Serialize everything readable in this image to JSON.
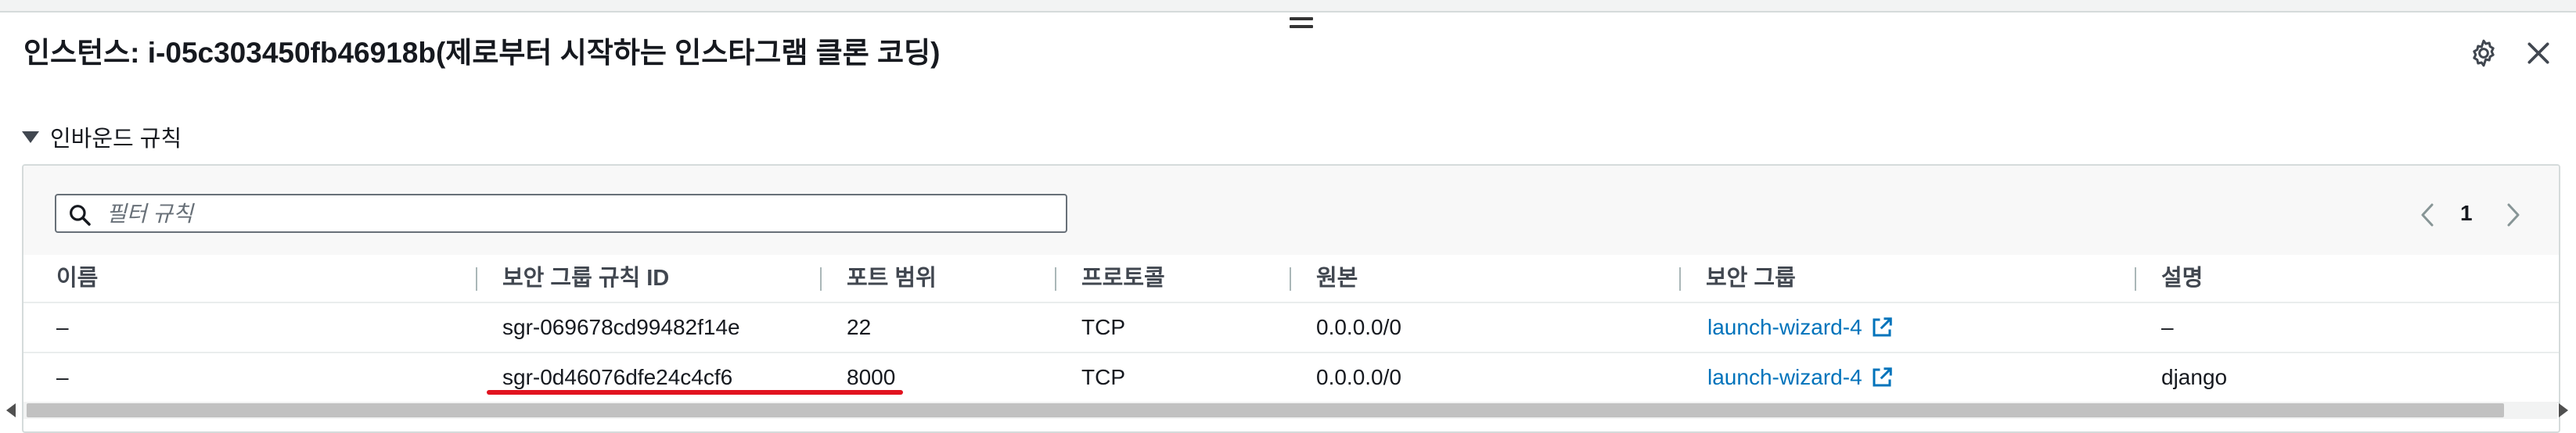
{
  "header": {
    "title": "인스턴스: i-05c303450fb46918b(제로부터 시작하는 인스타그램 클론 코딩)",
    "settings_icon": "gear-icon",
    "close_icon": "close-icon"
  },
  "section": {
    "label": "인바운드 규칙",
    "expanded": true
  },
  "filter": {
    "placeholder": "필터 규칙",
    "value": ""
  },
  "pagination": {
    "current_page": "1"
  },
  "table": {
    "columns": [
      "이름",
      "보안 그룹 규칙 ID",
      "포트 범위",
      "프로토콜",
      "원본",
      "보안 그룹",
      "설명"
    ],
    "rows": [
      {
        "name": "–",
        "rule_id": "sgr-069678cd99482f14e",
        "port_range": "22",
        "protocol": "TCP",
        "source": "0.0.0.0/0",
        "security_group": "launch-wizard-4",
        "description": "–"
      },
      {
        "name": "–",
        "rule_id": "sgr-0d46076dfe24c4cf6",
        "port_range": "8000",
        "protocol": "TCP",
        "source": "0.0.0.0/0",
        "security_group": "launch-wizard-4",
        "description": "django"
      }
    ]
  },
  "colors": {
    "link": "#0073bb",
    "highlight_underline": "#e1131f",
    "text": "#16191f"
  }
}
